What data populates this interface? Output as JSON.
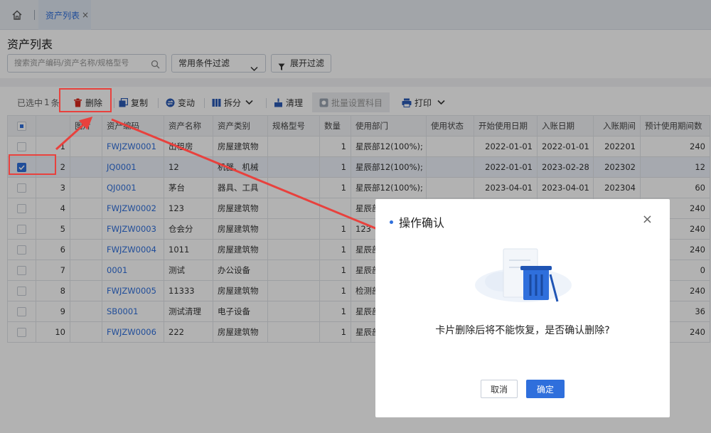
{
  "tabs": [
    {
      "label": "资产列表",
      "close": "×"
    }
  ],
  "page_title": "资产列表",
  "search": {
    "placeholder": "搜索资产编码/资产名称/规格型号"
  },
  "filter_dropdown": {
    "value": "常用条件过滤"
  },
  "expand_filter_label": "展开过滤",
  "toolbar": {
    "selected_text": "已选中",
    "selected_count": "1",
    "selected_unit": "条",
    "delete": "删除",
    "copy": "复制",
    "change": "变动",
    "split": "拆分",
    "clear": "清理",
    "batch_subject": "批量设置科目",
    "print": "打印"
  },
  "table": {
    "headers": [
      "",
      "",
      "图片",
      "资产编码",
      "资产名称",
      "资产类别",
      "规格型号",
      "数量",
      "使用部门",
      "使用状态",
      "开始使用日期",
      "入账日期",
      "入账期间",
      "预计使用期间数"
    ],
    "rows": [
      {
        "idx": "1",
        "code": "FWJZW0001",
        "name": "出租房",
        "cat": "房屋建筑物",
        "spec": "",
        "qty": "1",
        "dept": "星辰部12(100%);",
        "status": "",
        "start": "2022-01-01",
        "entry": "2022-01-01",
        "period": "202201",
        "life": "240",
        "checked": false
      },
      {
        "idx": "2",
        "code": "JQ0001",
        "name": "12",
        "cat": "机器、机械",
        "spec": "",
        "qty": "1",
        "dept": "星辰部12(100%);",
        "status": "",
        "start": "2022-01-01",
        "entry": "2023-02-28",
        "period": "202302",
        "life": "12",
        "checked": true
      },
      {
        "idx": "3",
        "code": "QJ0001",
        "name": "茅台",
        "cat": "器具、工具",
        "spec": "",
        "qty": "1",
        "dept": "星辰部12(100%);",
        "status": "",
        "start": "2023-04-01",
        "entry": "2023-04-01",
        "period": "202304",
        "life": "60",
        "checked": false
      },
      {
        "idx": "4",
        "code": "FWJZW0002",
        "name": "123",
        "cat": "房屋建筑物",
        "spec": "",
        "qty": "",
        "dept": "星辰部",
        "status": "",
        "start": "",
        "entry": "",
        "period": "",
        "life": "240",
        "checked": false
      },
      {
        "idx": "5",
        "code": "FWJZW0003",
        "name": "仓会分",
        "cat": "房屋建筑物",
        "spec": "",
        "qty": "1",
        "dept": "123",
        "status": "",
        "start": "",
        "entry": "",
        "period": "",
        "life": "240",
        "checked": false
      },
      {
        "idx": "6",
        "code": "FWJZW0004",
        "name": "1011",
        "cat": "房屋建筑物",
        "spec": "",
        "qty": "1",
        "dept": "星辰部",
        "status": "",
        "start": "",
        "entry": "",
        "period": "",
        "life": "240",
        "checked": false
      },
      {
        "idx": "7",
        "code": "0001",
        "name": "测试",
        "cat": "办公设备",
        "spec": "",
        "qty": "1",
        "dept": "星辰部",
        "status": "",
        "start": "",
        "entry": "",
        "period": "",
        "life": "0",
        "checked": false
      },
      {
        "idx": "8",
        "code": "FWJZW0005",
        "name": "11333",
        "cat": "房屋建筑物",
        "spec": "",
        "qty": "1",
        "dept": "检测部",
        "status": "",
        "start": "",
        "entry": "",
        "period": "",
        "life": "240",
        "checked": false
      },
      {
        "idx": "9",
        "code": "SB0001",
        "name": "测试清理",
        "cat": "电子设备",
        "spec": "",
        "qty": "1",
        "dept": "星辰部",
        "status": "",
        "start": "",
        "entry": "",
        "period": "",
        "life": "36",
        "checked": false
      },
      {
        "idx": "10",
        "code": "FWJZW0006",
        "name": "222",
        "cat": "房屋建筑物",
        "spec": "",
        "qty": "1",
        "dept": "星辰部",
        "status": "",
        "start": "",
        "entry": "",
        "period": "",
        "life": "240",
        "checked": false
      }
    ]
  },
  "dialog": {
    "title": "操作确认",
    "close": "×",
    "message": "卡片删除后将不能恢复，是否确认删除?",
    "cancel": "取消",
    "confirm": "确定"
  },
  "colors": {
    "primary": "#2f6fdc",
    "annotation": "#e8413d"
  }
}
